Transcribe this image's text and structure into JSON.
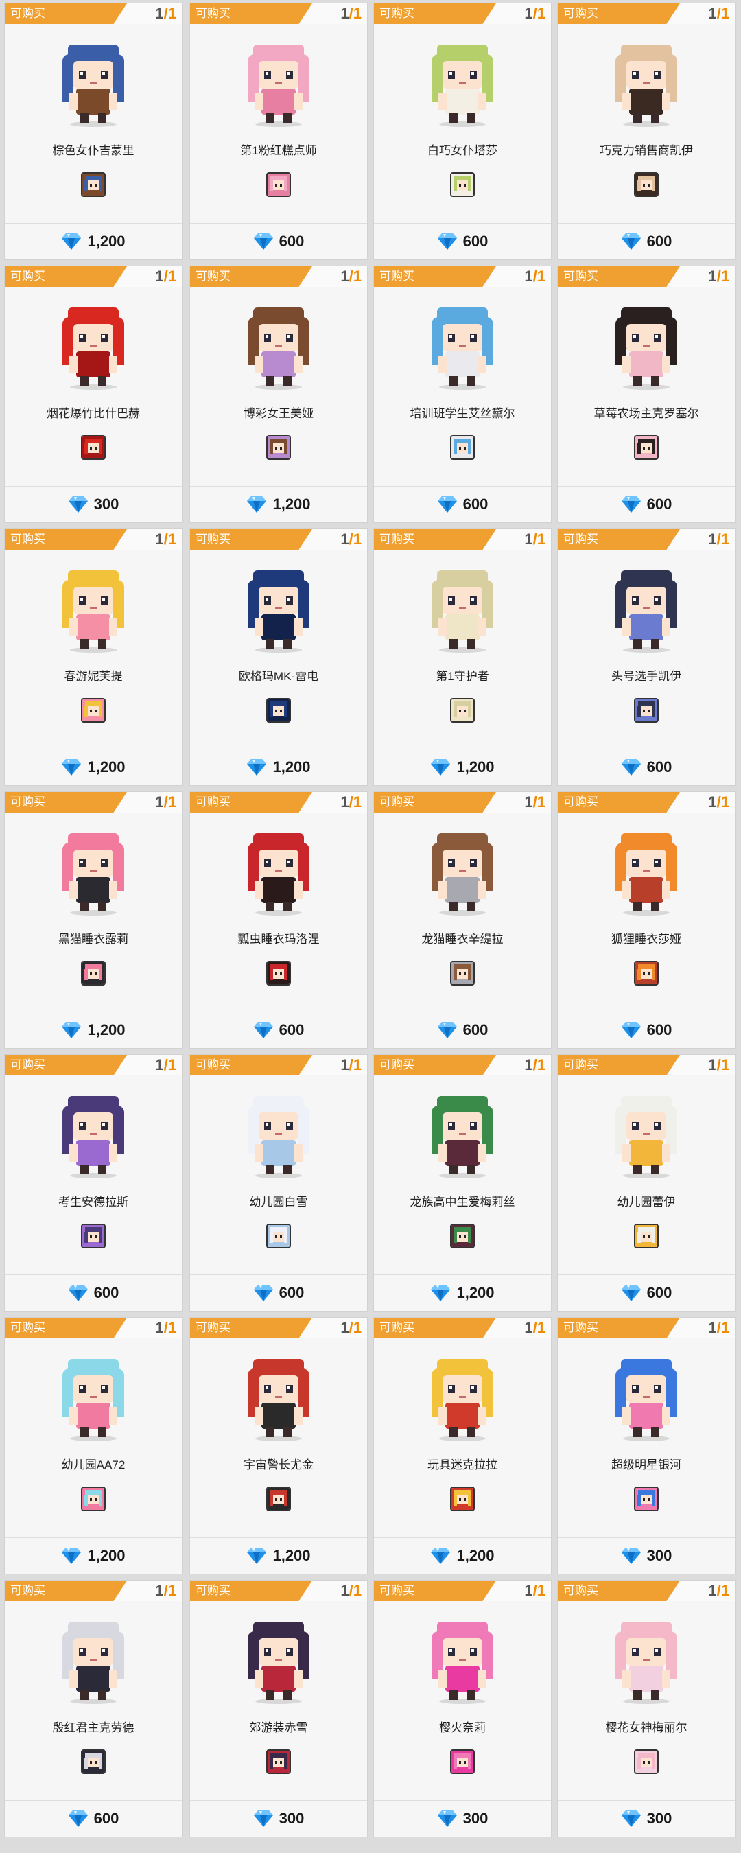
{
  "status_label": "可购买",
  "purchase_count": "1",
  "purchase_limit": "1",
  "currency_icon": "diamond-gem-icon",
  "accent_color": "#f0a030",
  "items": [
    {
      "name": "棕色女仆吉蒙里",
      "price": "1,200",
      "hair": "#3a5fa8",
      "outfit": "#7a4a2a"
    },
    {
      "name": "第1粉红糕点师",
      "price": "600",
      "hair": "#f2a7c3",
      "outfit": "#e77fa3"
    },
    {
      "name": "白巧女仆塔莎",
      "price": "600",
      "hair": "#b5cf6a",
      "outfit": "#f3efe5"
    },
    {
      "name": "巧克力销售商凯伊",
      "price": "600",
      "hair": "#e3c2a0",
      "outfit": "#3b2a22"
    },
    {
      "name": "烟花爆竹比什巴赫",
      "price": "300",
      "hair": "#d8281f",
      "outfit": "#a51616"
    },
    {
      "name": "博彩女王美娅",
      "price": "1,200",
      "hair": "#7a4b2e",
      "outfit": "#b88ad0"
    },
    {
      "name": "培训班学生艾丝黛尔",
      "price": "600",
      "hair": "#5aa9df",
      "outfit": "#e9e9ee"
    },
    {
      "name": "草莓农场主克罗塞尔",
      "price": "600",
      "hair": "#2a2020",
      "outfit": "#f1b7c6"
    },
    {
      "name": "春游妮芙提",
      "price": "1,200",
      "hair": "#f2c23a",
      "outfit": "#f58fa6"
    },
    {
      "name": "欧格玛MK-雷电",
      "price": "1,200",
      "hair": "#1f3a7a",
      "outfit": "#12224a"
    },
    {
      "name": "第1守护者",
      "price": "1,200",
      "hair": "#d8cfa0",
      "outfit": "#efe6c8"
    },
    {
      "name": "头号选手凯伊",
      "price": "600",
      "hair": "#2f3550",
      "outfit": "#6b7bd0"
    },
    {
      "name": "黑猫睡衣露莉",
      "price": "1,200",
      "hair": "#f27a9c",
      "outfit": "#2a2a30"
    },
    {
      "name": "瓢虫睡衣玛洛涅",
      "price": "600",
      "hair": "#c8262b",
      "outfit": "#2a1a1a"
    },
    {
      "name": "龙猫睡衣辛缇拉",
      "price": "600",
      "hair": "#8a5a3a",
      "outfit": "#a8a8b0"
    },
    {
      "name": "狐狸睡衣莎娅",
      "price": "600",
      "hair": "#f08a2a",
      "outfit": "#b8402a"
    },
    {
      "name": "考生安德拉斯",
      "price": "600",
      "hair": "#4a3a7a",
      "outfit": "#9a6ad0"
    },
    {
      "name": "幼儿园白雪",
      "price": "600",
      "hair": "#eef2f8",
      "outfit": "#a8c8e8"
    },
    {
      "name": "龙族高中生爱梅莉丝",
      "price": "1,200",
      "hair": "#3a8a4a",
      "outfit": "#5a2a3a"
    },
    {
      "name": "幼儿园蕾伊",
      "price": "600",
      "hair": "#f0f0ea",
      "outfit": "#f2b73a"
    },
    {
      "name": "幼儿园AA72",
      "price": "1,200",
      "hair": "#8ad8e8",
      "outfit": "#f07aa0"
    },
    {
      "name": "宇宙警长尤金",
      "price": "1,200",
      "hair": "#c8372b",
      "outfit": "#2a2a2a"
    },
    {
      "name": "玩具迷克拉拉",
      "price": "1,200",
      "hair": "#f2c23a",
      "outfit": "#d03a2a"
    },
    {
      "name": "超级明星银河",
      "price": "300",
      "hair": "#3a78e0",
      "outfit": "#f07ab0"
    },
    {
      "name": "殷红君主克劳德",
      "price": "600",
      "hair": "#d8d8e0",
      "outfit": "#2a2a38"
    },
    {
      "name": "郊游装赤雪",
      "price": "300",
      "hair": "#3a2a4a",
      "outfit": "#b8283a"
    },
    {
      "name": "樱火奈莉",
      "price": "300",
      "hair": "#f07ab8",
      "outfit": "#e83aa0"
    },
    {
      "name": "樱花女神梅丽尔",
      "price": "300",
      "hair": "#f5b8c8",
      "outfit": "#f2d0e0"
    }
  ]
}
